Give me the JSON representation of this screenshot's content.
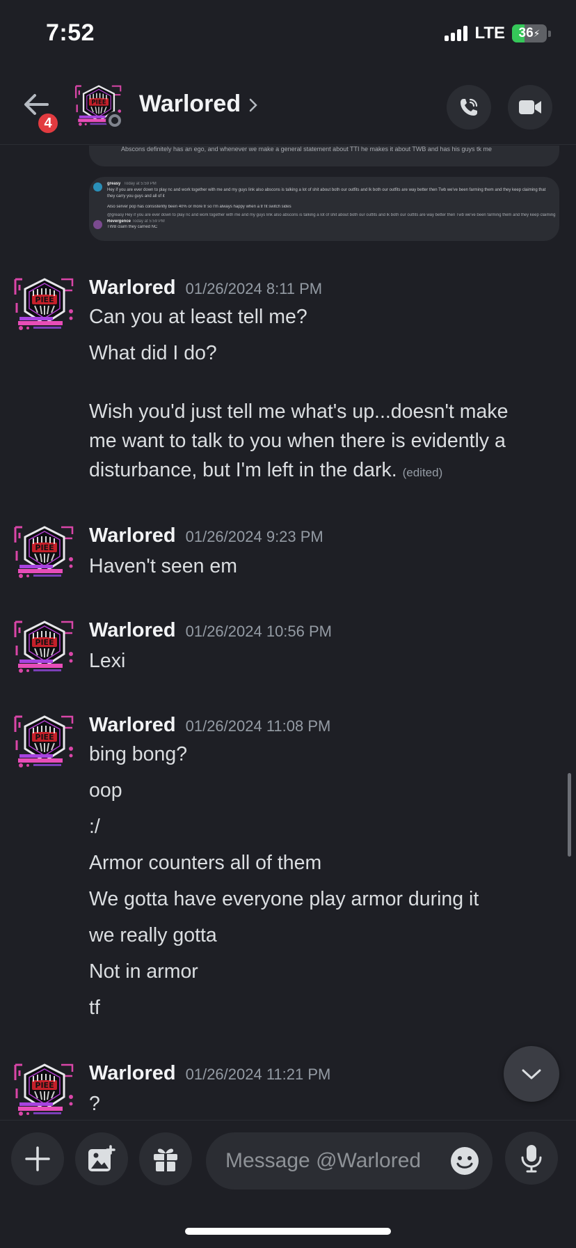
{
  "status_bar": {
    "time": "7:52",
    "network": "LTE",
    "battery": "36",
    "battery_level": 0.36
  },
  "header": {
    "back_badge": "4",
    "title": "Warlored"
  },
  "embed": {
    "top_text": "Abscons definitely has an ego, and whenever we make a general statement about TTI he makes it about TWB and has his guys tk me",
    "line1_name": "greasy",
    "line1_time": "Today at 5:59 PM",
    "line1_body": "Hey if you are ever down to play nc and work together with me and my guys link also abscons is talking a lot of shit about both our outfits and lk both our outfits are way better then Twb we've been farming them and they keep claiming that they carry you guys and all of it",
    "line2": "Also server pop has consistently been 40% or more tr so I'm always happy when a tr fit switch sides",
    "reply_ref": "@greasy Hey if you are ever down to play nc and work together with me and my guys link also abscons is talking a lot of shit about both our outfits and lk both our outfits are way better then Twb we've been farming them and they keep claiming that they carry you guys a",
    "line3_name": "Revergence",
    "line3_time": "Today at 5:59 PM",
    "line3_body": "TWB claim they carried NC"
  },
  "messages": [
    {
      "author": "Warlored",
      "timestamp": "01/26/2024 8:11 PM",
      "lines": [
        "Can you at least tell me?",
        "What did I do?",
        "Wish you'd just tell me what's up...doesn't make",
        "me want to talk to you when there is evidently a",
        "disturbance, but I'm left in the dark."
      ],
      "edited": "(edited)"
    },
    {
      "author": "Warlored",
      "timestamp": "01/26/2024 9:23 PM",
      "lines": [
        "Haven't seen em"
      ]
    },
    {
      "author": "Warlored",
      "timestamp": "01/26/2024 10:56 PM",
      "lines": [
        "Lexi"
      ]
    },
    {
      "author": "Warlored",
      "timestamp": "01/26/2024 11:08 PM",
      "lines": [
        "bing bong?",
        "oop",
        ":/",
        "Armor counters all of them",
        "We gotta have everyone play armor during it",
        "we really gotta",
        "Not in armor",
        "tf"
      ]
    },
    {
      "author": "Warlored",
      "timestamp": "01/26/2024 11:21 PM",
      "lines": [
        "?"
      ]
    }
  ],
  "composer": {
    "placeholder": "Message @Warlored"
  },
  "icons": {
    "back": "arrow-left-icon",
    "phone": "phone-call-icon",
    "video": "video-camera-icon",
    "plus": "plus-icon",
    "gallery": "image-icon",
    "gift": "gift-icon",
    "emoji": "emoji-icon",
    "mic": "microphone-icon",
    "jump": "chevron-down-icon"
  },
  "colors": {
    "background": "#1e1f25",
    "surface": "#2b2d33",
    "badge": "#e23b40",
    "battery": "#35c759",
    "muted": "#949ba4"
  }
}
